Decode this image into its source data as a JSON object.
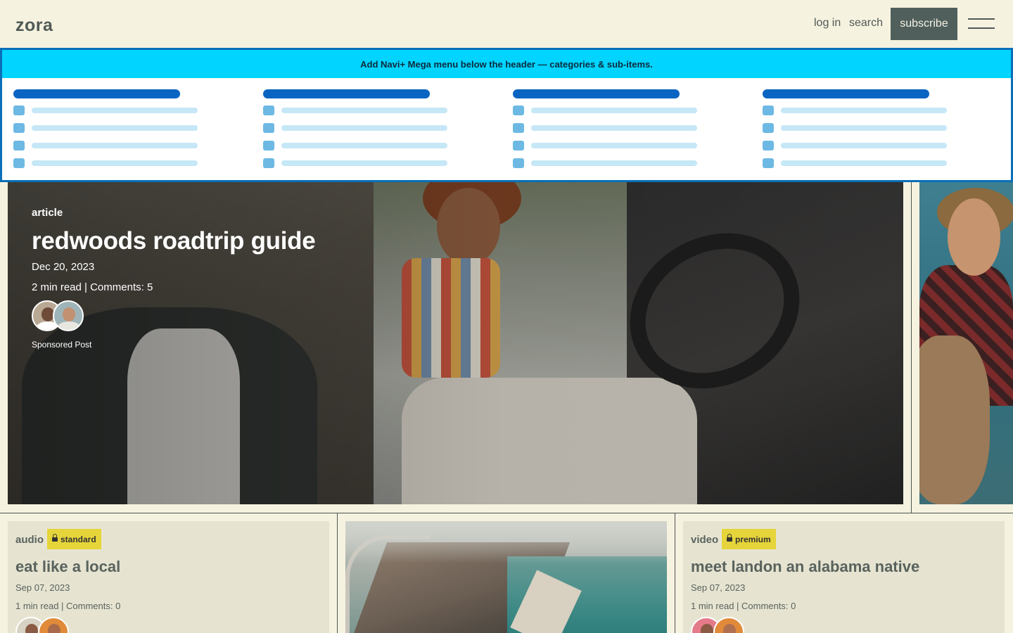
{
  "header": {
    "logo": "zora",
    "login": "log in",
    "search": "search",
    "subscribe": "subscribe"
  },
  "mega_menu": {
    "banner": "Add Navi+ Mega menu below the header — categories & sub-items.",
    "columns": 4,
    "rows_per_column": 4
  },
  "hero": {
    "type": "article",
    "title": "redwoods roadtrip guide",
    "date": "Dec 20, 2023",
    "meta": "2 min read | Comments: 5",
    "sponsored": "Sponsored Post"
  },
  "cards": [
    {
      "type": "audio",
      "tag": "standard",
      "title": "eat like a local",
      "date": "Sep 07, 2023",
      "meta": "1 min read | Comments: 0"
    },
    {
      "type": "video",
      "tag": "premium",
      "title": "meet landon an alabama native",
      "date": "Sep 07, 2023",
      "meta": "1 min read | Comments: 0"
    }
  ],
  "colors": {
    "background": "#f6f2e0",
    "subscribe_button": "#505f5b",
    "banner": "#00d4ff",
    "tag": "#e6d53a",
    "card": "#e6e4d1"
  },
  "icons": [
    "hamburger-menu-icon",
    "lock-icon"
  ]
}
